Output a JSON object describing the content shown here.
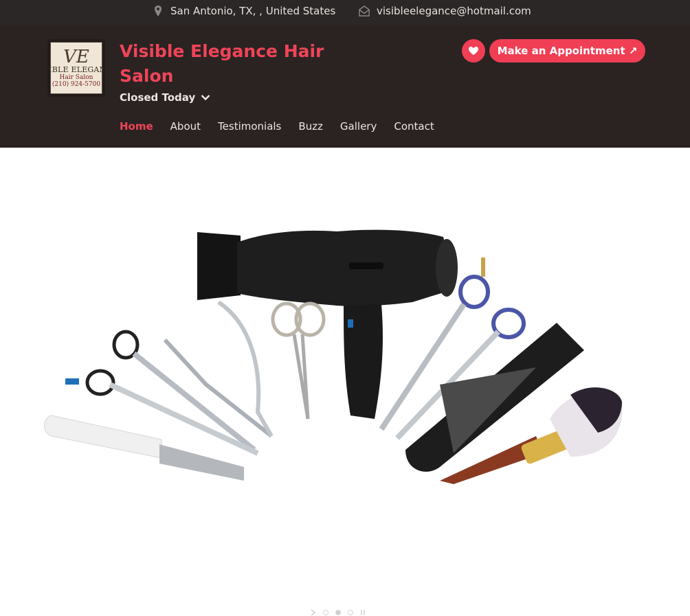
{
  "topbar": {
    "location": "San Antonio, TX, , United States",
    "email": "visibleelegance@hotmail.com"
  },
  "header": {
    "logo": {
      "monogram": "VE",
      "line1": "VISIBLE ELEGANCE",
      "line2": "Hair Salon",
      "line3": "(210) 924-5700"
    },
    "title": "Visible Elegance Hair Salon",
    "status": "Closed Today",
    "appointment_label": "Make an Appointment ↗"
  },
  "nav": {
    "items": [
      {
        "label": "Home",
        "active": true
      },
      {
        "label": "About"
      },
      {
        "label": "Testimonials"
      },
      {
        "label": "Buzz"
      },
      {
        "label": "Gallery"
      },
      {
        "label": "Contact"
      }
    ]
  },
  "colors": {
    "accent": "#f03e55",
    "header_bg": "#2a2322",
    "topbar_bg": "#2b2726"
  },
  "icons": {
    "location": "map-pin-icon",
    "email": "envelope-icon",
    "status": "chevron-down-icon",
    "favorite": "heart-icon"
  },
  "slider": {
    "slide_count": 4,
    "active_index": 1
  }
}
